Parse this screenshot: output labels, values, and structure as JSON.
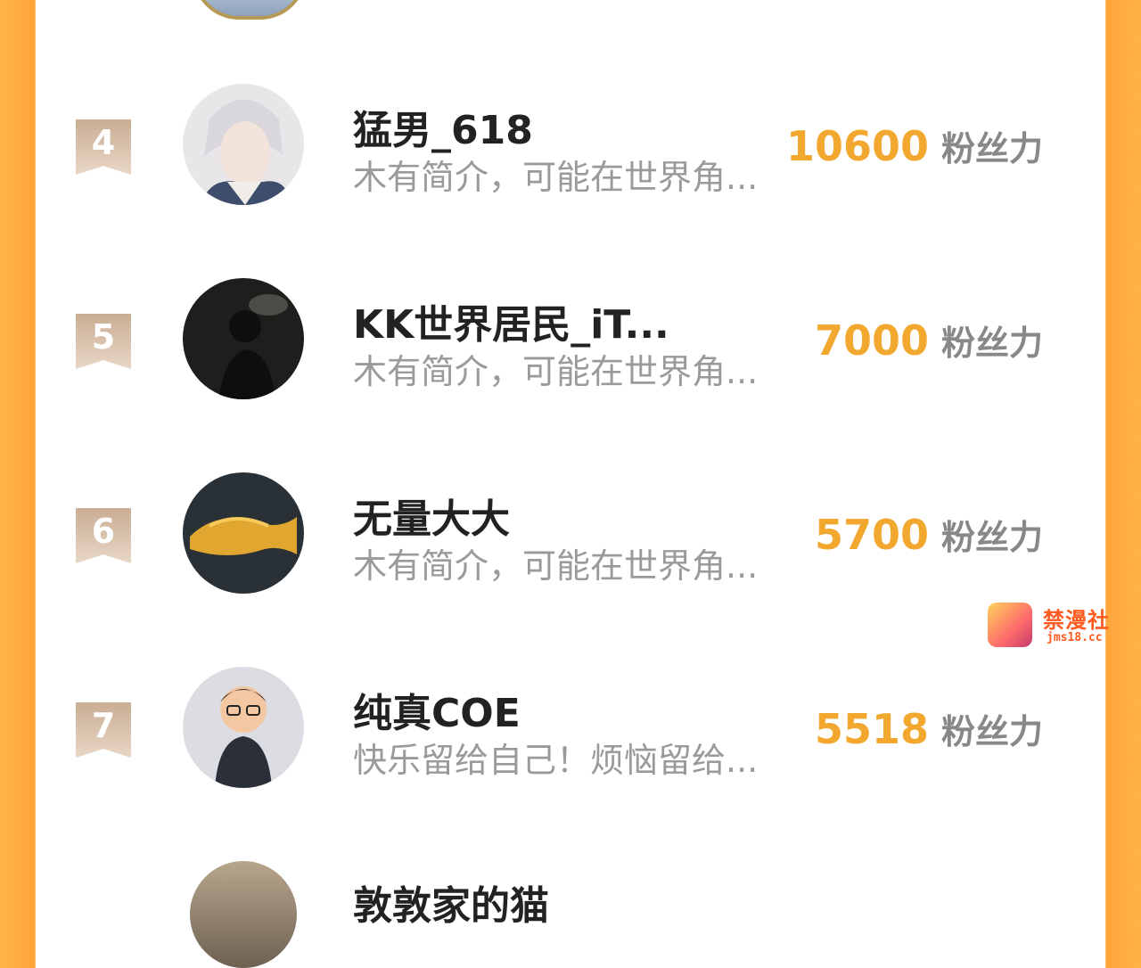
{
  "ranking": {
    "fans_unit": "粉丝力",
    "entries": [
      {
        "rank": "4",
        "name": "猛男_618",
        "bio": "木有简介，可能在世界角...",
        "fans": "10600"
      },
      {
        "rank": "5",
        "name": "KK世界居民_iT...",
        "bio": "木有简介，可能在世界角...",
        "fans": "7000"
      },
      {
        "rank": "6",
        "name": "无量大大",
        "bio": "木有简介，可能在世界角...",
        "fans": "5700"
      },
      {
        "rank": "7",
        "name": "纯真COE",
        "bio": "快乐留给自己！烦恼留给...",
        "fans": "5518"
      }
    ],
    "partial_next": {
      "name": "敦敦家的猫"
    }
  },
  "watermark": {
    "title": "禁漫社",
    "url": "jms18.cc"
  },
  "colors": {
    "accent": "#f2a72e",
    "side_gradient": "#ffa53a",
    "rank_badge": "#c9ad93"
  }
}
